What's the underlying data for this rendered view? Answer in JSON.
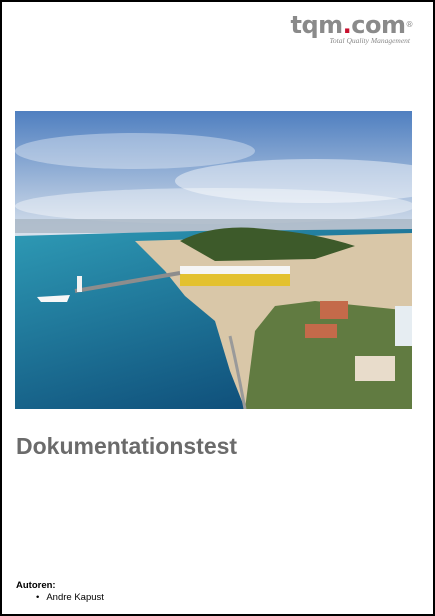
{
  "logo": {
    "brand_main": "tqm",
    "brand_dot": ".",
    "brand_tld": "com",
    "registered_mark": "®",
    "tagline": "Total Quality Management"
  },
  "cover_photo": {
    "icon": "coastal-city-photo",
    "colors": {
      "sky_top": "#4f7fc0",
      "sky_bottom": "#dfe6ee",
      "sea_deep": "#0f4f7a",
      "sea_light": "#2e9ab5",
      "hill": "#3d5a2a",
      "city": "#d9c7a8",
      "roofs": "#c46a4a",
      "ferry": "#e3c12f"
    }
  },
  "document": {
    "title": "Dokumentationstest"
  },
  "authors": {
    "heading": "Autoren:",
    "names": [
      "Andre Kapust"
    ]
  }
}
